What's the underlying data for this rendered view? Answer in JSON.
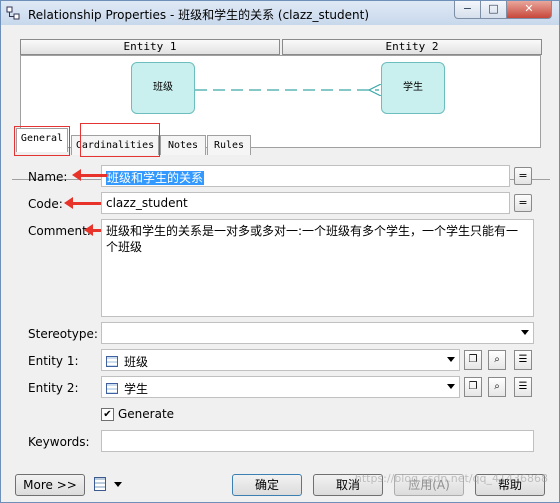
{
  "window": {
    "title": "Relationship Properties - 班级和学生的关系 (clazz_student)",
    "minimize": "−",
    "maximize": "□",
    "close": "✕"
  },
  "entity_headers": {
    "entity1": "Entity 1",
    "entity2": "Entity 2"
  },
  "preview": {
    "entity1_name": "班级",
    "entity2_name": "学生"
  },
  "tabs": [
    {
      "label": "General"
    },
    {
      "label": "Cardinalities"
    },
    {
      "label": "Notes"
    },
    {
      "label": "Rules"
    }
  ],
  "form": {
    "name_label": "Name:",
    "name_value": "班级和学生的关系",
    "code_label": "Code:",
    "code_value": "clazz_student",
    "comment_label": "Comment:",
    "comment_value": "班级和学生的关系是一对多或多对一:一个班级有多个学生，一个学生只能有一个班级",
    "stereotype_label": "Stereotype:",
    "stereotype_value": "",
    "entity1_label": "Entity 1:",
    "entity1_value": "班级",
    "entity2_label": "Entity 2:",
    "entity2_value": "学生",
    "generate_label": "Generate",
    "generate_checked": "✔",
    "keywords_label": "Keywords:",
    "keywords_value": "",
    "equals": "="
  },
  "buttons": {
    "more": "More >>",
    "ok": "确定",
    "cancel": "取消",
    "apply": "应用(A)",
    "help": "帮助"
  },
  "watermark": "https://blog.csdn.net/qq_41436868",
  "colors": {
    "annotation_red": "#e8332a",
    "entity_fill": "#c9f0ee",
    "selection": "#3399ff"
  }
}
